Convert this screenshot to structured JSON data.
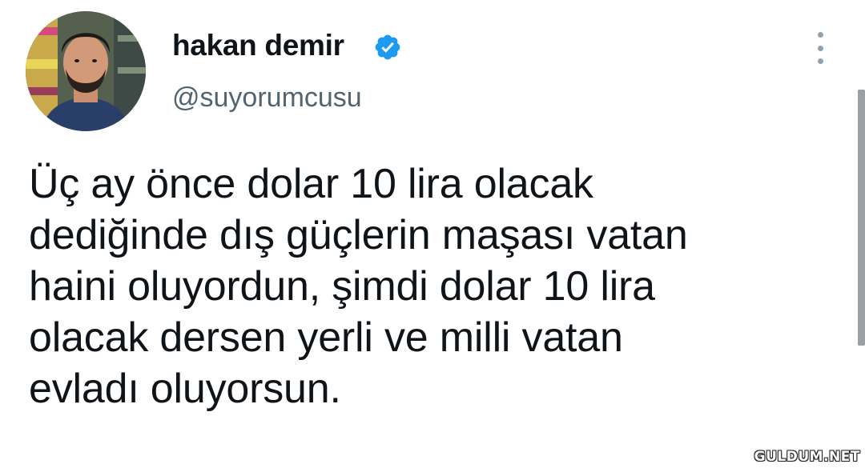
{
  "tweet": {
    "author": {
      "display_name": "hakan demir",
      "handle": "@suyorumcusu",
      "verified": true,
      "verified_icon": "verified-badge-icon",
      "avatar_icon": "profile-photo"
    },
    "more_icon": "more-vertical-icon",
    "text_lines": [
      "Üç ay önce dolar 10 lira olacak",
      "dediğinde dış güçlerin maşası vatan",
      "haini oluyordun, şimdi dolar 10 lira",
      "olacak dersen yerli ve milli vatan",
      "evladı oluyorsun."
    ]
  },
  "watermark": "GULDUM.NET",
  "colors": {
    "text_primary": "#0f1419",
    "text_secondary": "#536471",
    "verified_blue": "#1d9bf0",
    "more_dots": "#8fa1ae",
    "background": "#ffffff"
  }
}
